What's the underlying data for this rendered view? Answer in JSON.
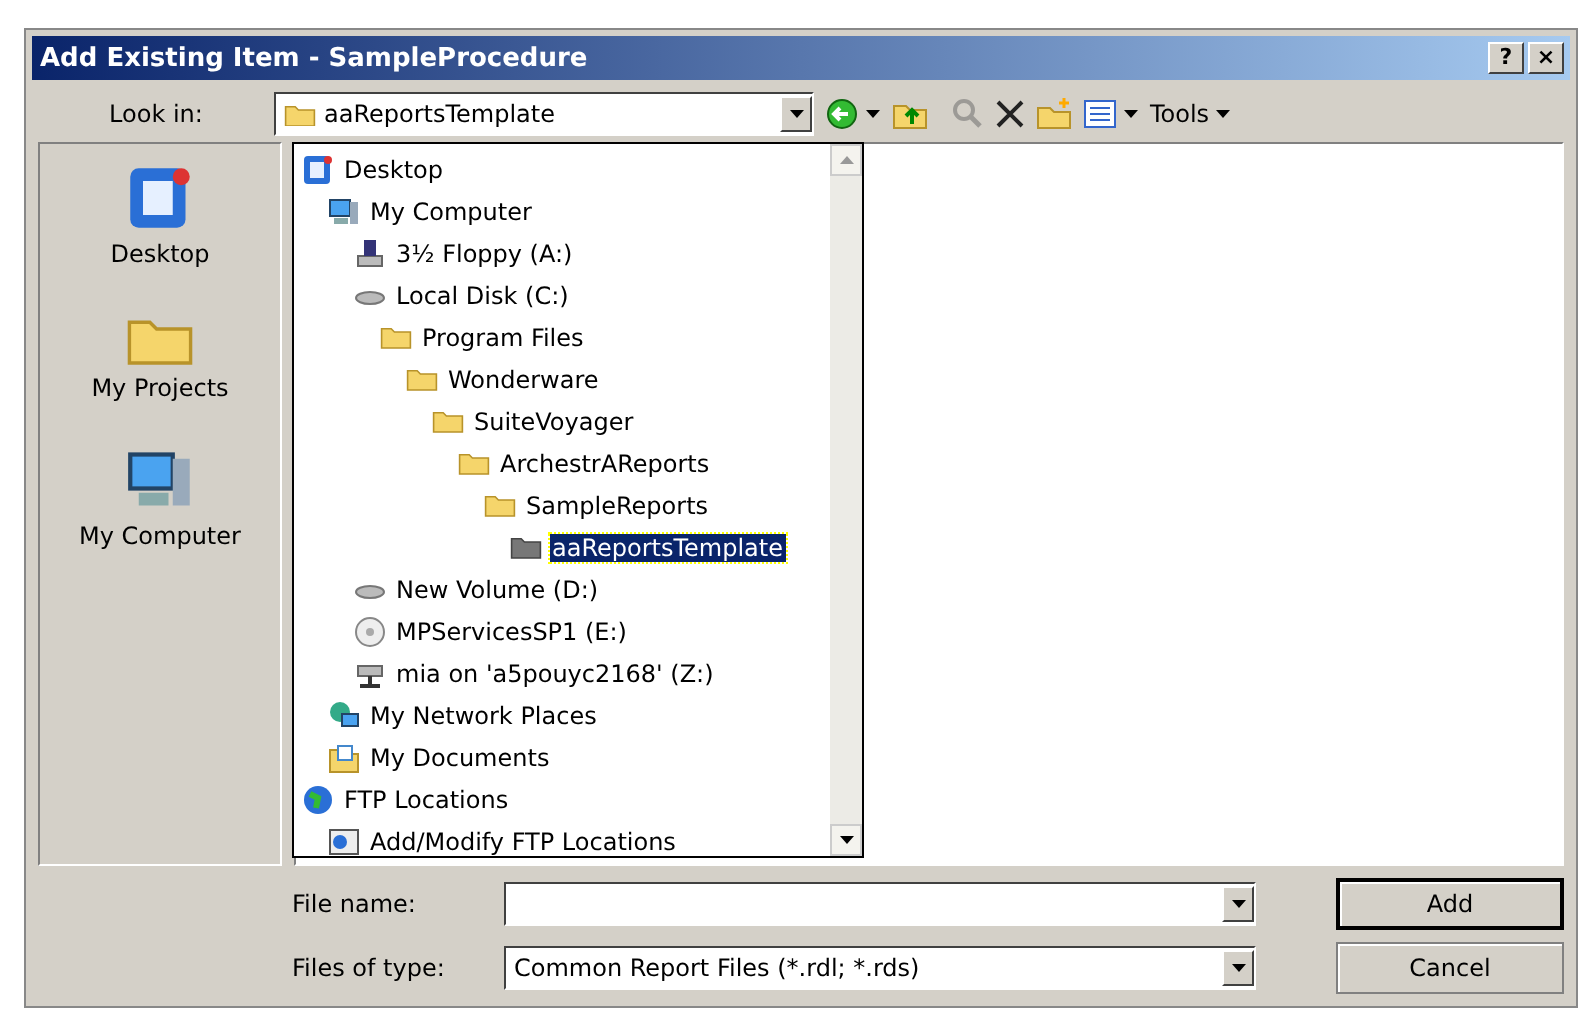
{
  "window": {
    "title": "Add Existing Item - SampleProcedure",
    "help_button": "?",
    "close_button": "×"
  },
  "look_in": {
    "label": "Look in:",
    "value": "aaReportsTemplate"
  },
  "toolbar": {
    "tools_label": "Tools"
  },
  "places": [
    {
      "label": "Desktop",
      "kind": "desktop"
    },
    {
      "label": "My Projects",
      "kind": "folder"
    },
    {
      "label": "My Computer",
      "kind": "computer"
    }
  ],
  "tree": [
    {
      "label": "Desktop",
      "kind": "desktop",
      "selected": false,
      "children": [
        {
          "label": "My Computer",
          "kind": "computer",
          "selected": false,
          "children": [
            {
              "label": "3½ Floppy (A:)",
              "kind": "floppy",
              "selected": false
            },
            {
              "label": "Local Disk (C:)",
              "kind": "disk",
              "selected": false,
              "children": [
                {
                  "label": "Program Files",
                  "kind": "folder",
                  "selected": false,
                  "children": [
                    {
                      "label": "Wonderware",
                      "kind": "folder",
                      "selected": false,
                      "children": [
                        {
                          "label": "SuiteVoyager",
                          "kind": "folder",
                          "selected": false,
                          "children": [
                            {
                              "label": "ArchestrAReports",
                              "kind": "folder",
                              "selected": false,
                              "children": [
                                {
                                  "label": "SampleReports",
                                  "kind": "folder",
                                  "selected": false,
                                  "children": [
                                    {
                                      "label": "aaReportsTemplate",
                                      "kind": "folder",
                                      "selected": true
                                    }
                                  ]
                                }
                              ]
                            }
                          ]
                        }
                      ]
                    }
                  ]
                }
              ]
            },
            {
              "label": "New Volume (D:)",
              "kind": "disk",
              "selected": false
            },
            {
              "label": "MPServicesSP1 (E:)",
              "kind": "cdrom",
              "selected": false
            },
            {
              "label": "mia on 'a5pouyc2168' (Z:)",
              "kind": "netdrive",
              "selected": false
            }
          ]
        },
        {
          "label": "My Network Places",
          "kind": "network",
          "selected": false
        },
        {
          "label": "My Documents",
          "kind": "documents",
          "selected": false
        }
      ]
    },
    {
      "label": "FTP Locations",
      "kind": "ftp",
      "selected": false,
      "children": [
        {
          "label": "Add/Modify FTP Locations",
          "kind": "ftpadd",
          "selected": false
        }
      ]
    }
  ],
  "file_name": {
    "label": "File name:"
  },
  "file_type": {
    "label": "Files of type:",
    "value": "Common Report Files (*.rdl; *.rds)"
  },
  "buttons": [
    "Add",
    "Cancel"
  ]
}
